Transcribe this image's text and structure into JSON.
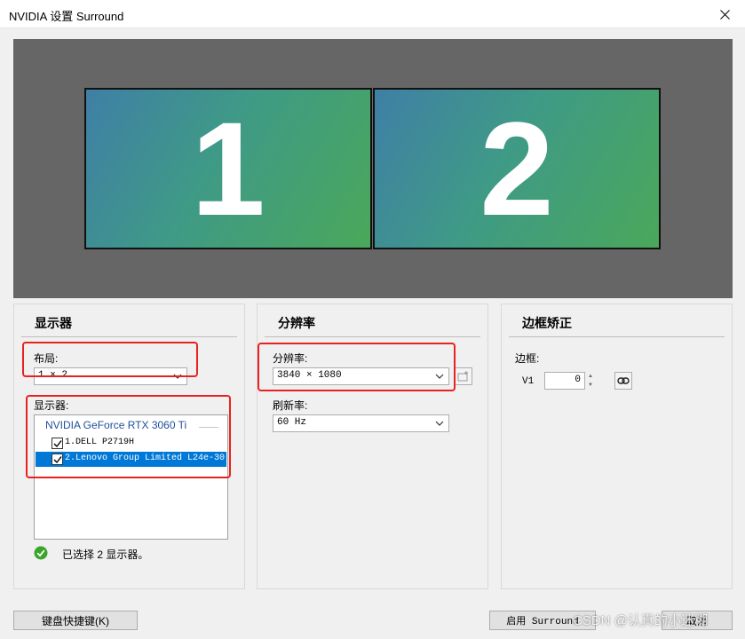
{
  "window": {
    "title": "NVIDIA 设置 Surround"
  },
  "preview": {
    "monitors": [
      "1",
      "2"
    ]
  },
  "displays_group": {
    "header": "显示器",
    "layout_label": "布局:",
    "layout_value": "1 × 2",
    "displays_label": "显示器:",
    "gpu_name": "NVIDIA GeForce RTX 3060 Ti",
    "displays": [
      {
        "label": "1.DELL P2719H",
        "checked": true
      },
      {
        "label": "2.Lenovo Group Limited L24e-30",
        "checked": true
      }
    ],
    "status_text": "已选择 2 显示器。"
  },
  "resolution_group": {
    "header": "分辨率",
    "resolution_label": "分辨率:",
    "resolution_value": "3840 × 1080",
    "refresh_label": "刷新率:",
    "refresh_value": "60 Hz"
  },
  "bezel_group": {
    "header": "边框矫正",
    "bezel_label": "边框:",
    "v1_label": "V1",
    "v1_value": "0"
  },
  "buttons": {
    "shortcuts": "键盘快捷键(K)",
    "enable_surround": "启用 Surround",
    "cancel": "取消"
  },
  "watermark": "CSDN @认真的小迷糊",
  "colors": {
    "highlight": "#0078d7",
    "annotation_red": "#e8231f",
    "gpu_text": "#1f4f9a"
  }
}
